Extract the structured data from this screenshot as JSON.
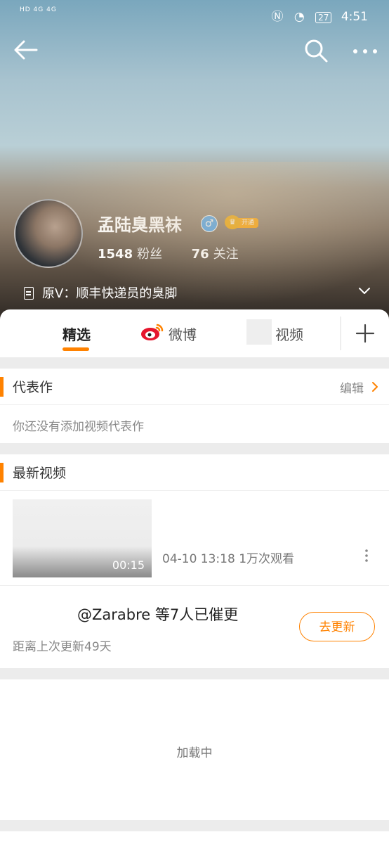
{
  "status_bar": {
    "left_text": "HD 4G 4G",
    "battery": "27",
    "time": "4:51"
  },
  "profile": {
    "name": "孟陆臭黑袜",
    "gender_symbol": "♂",
    "vip_label": "开通",
    "followers_count": "1548",
    "followers_label": "粉丝",
    "following_count": "76",
    "following_label": "关注",
    "bio": "原V：顺丰快递员的臭脚"
  },
  "tabs": [
    {
      "label": "精选"
    },
    {
      "label": "微博"
    },
    {
      "label": "视频"
    }
  ],
  "masterpiece": {
    "title": "代表作",
    "edit_label": "编辑",
    "empty_text": "你还没有添加视频代表作"
  },
  "latest_videos": {
    "title": "最新视频",
    "items": [
      {
        "duration": "00:15",
        "meta": "04-10 13:18 1万次观看"
      }
    ]
  },
  "urge": {
    "text": "@Zarabre 等7人已催更",
    "since_text": "距离上次更新49天",
    "button_label": "去更新"
  },
  "loading_text": "加载中",
  "colors": {
    "accent": "#ff8200",
    "verified_blue": "#4aa3ee",
    "vip_gold": "#ffa200"
  }
}
